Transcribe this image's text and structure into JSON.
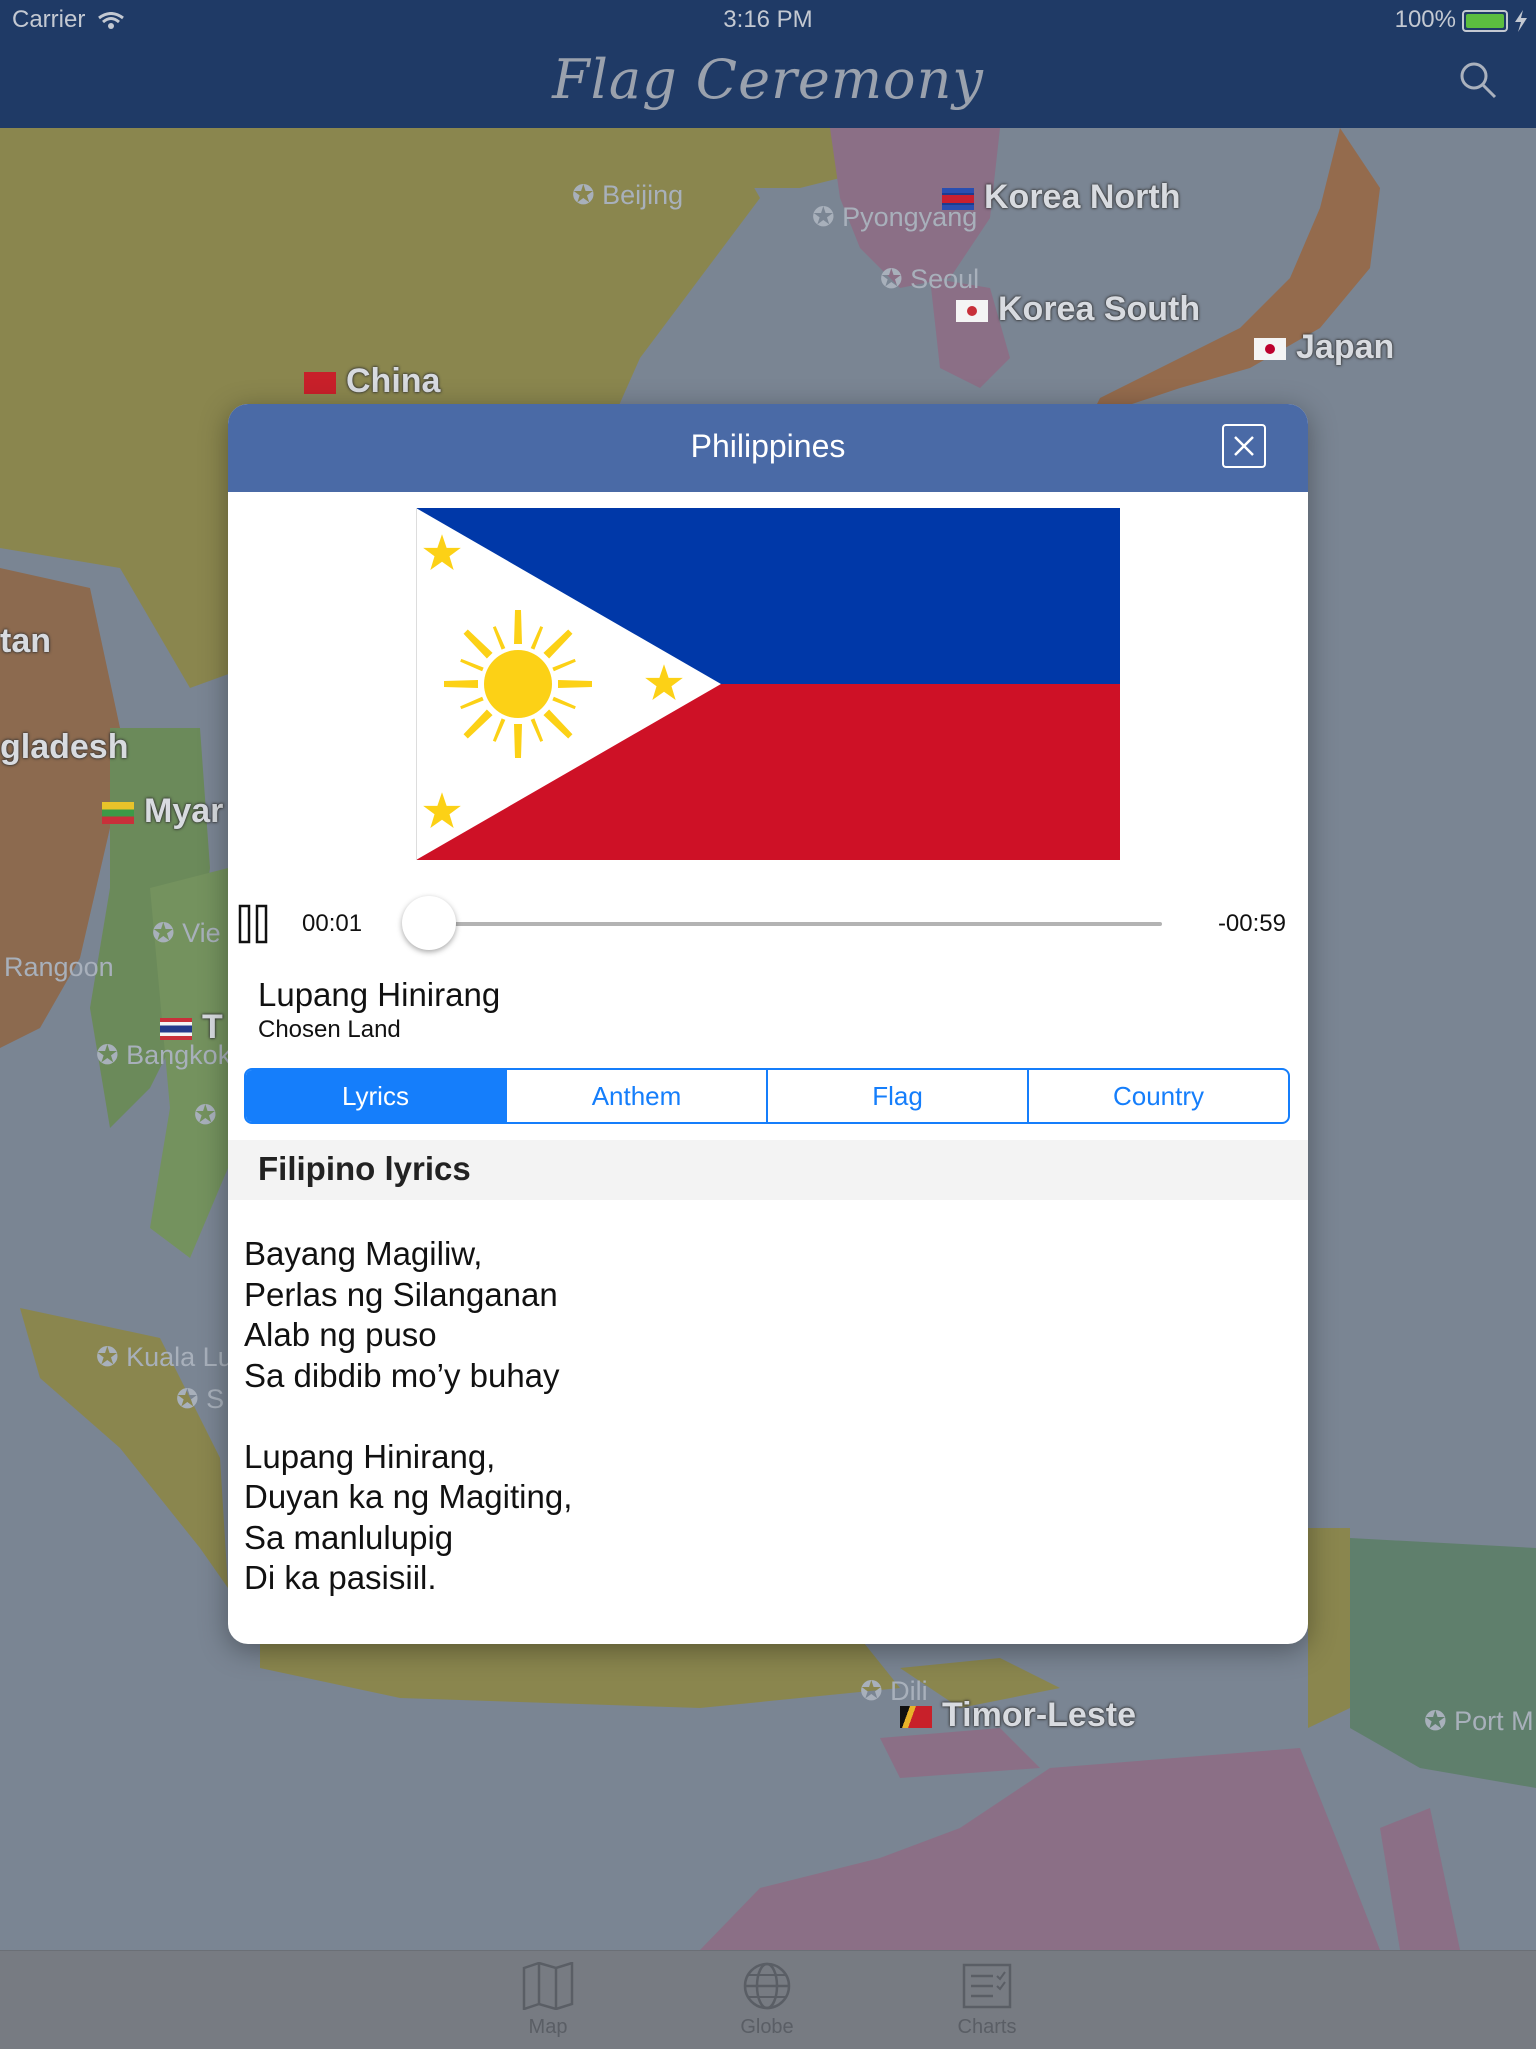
{
  "status_bar": {
    "carrier": "Carrier",
    "time": "3:16 PM",
    "battery": "100%"
  },
  "nav": {
    "title": "Flag Ceremony",
    "search_icon": "search-icon"
  },
  "map": {
    "countries": [
      "Korea North",
      "Korea South",
      "Japan",
      "China",
      "tan",
      "gladesh",
      "Myar",
      "T",
      "Timor-Leste"
    ],
    "cities": [
      "Beijing",
      "Pyongyang",
      "Seoul",
      "Vie",
      "Rangoon",
      "Bangkok",
      "Kuala Lu",
      "S",
      "Dili",
      "Port M"
    ]
  },
  "modal": {
    "title": "Philippines",
    "close_icon": "close-icon",
    "player": {
      "elapsed": "00:01",
      "remaining": "-00:59",
      "progress": 0.02
    },
    "song_title": "Lupang Hinirang",
    "song_subtitle": "Chosen Land",
    "tabs": [
      {
        "label": "Lyrics",
        "active": true
      },
      {
        "label": "Anthem",
        "active": false
      },
      {
        "label": "Flag",
        "active": false
      },
      {
        "label": "Country",
        "active": false
      }
    ],
    "section_title": "Filipino lyrics",
    "lyrics": {
      "stanza1": [
        "Bayang Magiliw,",
        "Perlas ng Silanganan",
        "Alab ng puso",
        "Sa dibdib mo’y buhay"
      ],
      "stanza2": [
        "Lupang Hinirang,",
        "Duyan ka ng Magiting,",
        "Sa manlulupig",
        "Di ka pasisiil."
      ]
    }
  },
  "tab_bar": [
    {
      "label": "Map",
      "icon": "map-icon"
    },
    {
      "label": "Globe",
      "icon": "globe-icon"
    },
    {
      "label": "Charts",
      "icon": "charts-icon"
    }
  ],
  "colors": {
    "nav_bg": "#1f3a66",
    "modal_header": "#4a6aa6",
    "accent": "#157efb",
    "flag_blue": "#0038a8",
    "flag_red": "#ce1126",
    "flag_yellow": "#fcd116"
  }
}
